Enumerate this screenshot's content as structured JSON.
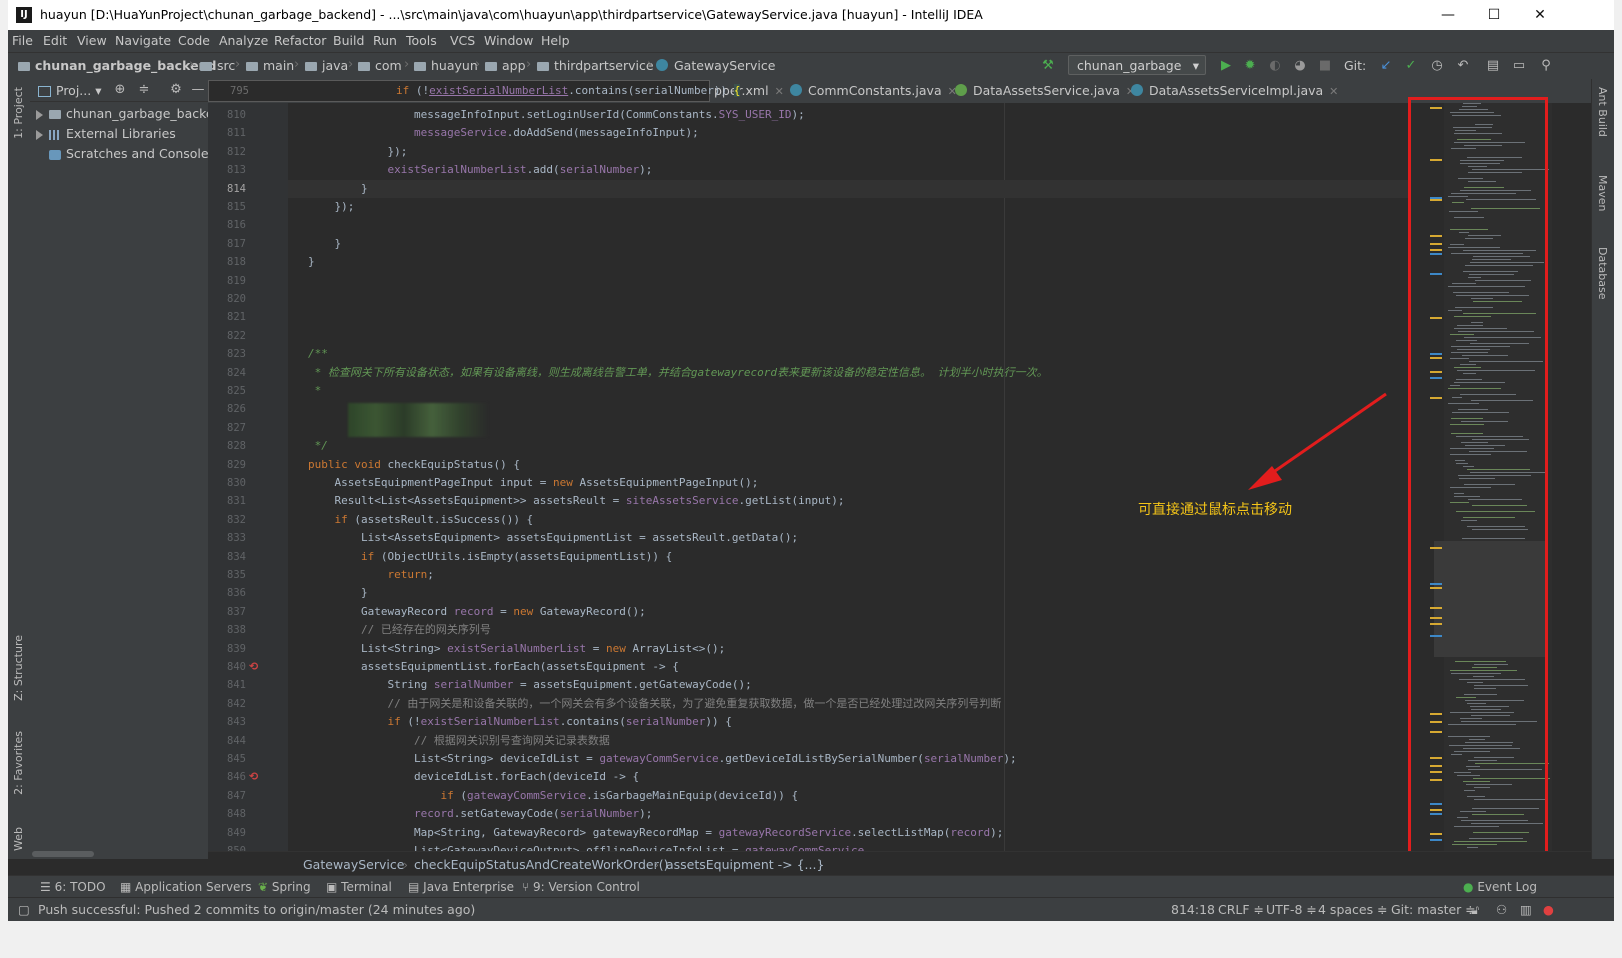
{
  "window": {
    "title": "huayun [D:\\HuaYunProject\\chunan_garbage_backend] - ...\\src\\main\\java\\com\\huayun\\app\\thirdpartservice\\GatewayService.java [huayun] - IntelliJ IDEA",
    "app_icon": "IJ",
    "minimize": "—",
    "maximize": "☐",
    "close": "✕"
  },
  "menu": [
    "File",
    "Edit",
    "View",
    "Navigate",
    "Code",
    "Analyze",
    "Refactor",
    "Build",
    "Run",
    "Tools",
    "VCS",
    "Window",
    "Help"
  ],
  "navbar": {
    "crumbs": [
      "chunan_garbage_backend",
      "src",
      "main",
      "java",
      "com",
      "huayun",
      "app",
      "thirdpartservice",
      "GatewayService"
    ],
    "run_config": "chunan_garbage",
    "git_label": "Git:"
  },
  "left_tools": {
    "project": "1: Project",
    "structure": "Z: Structure",
    "favorites": "2: Favorites",
    "web": "Web"
  },
  "right_tools": {
    "ant": "Ant Build",
    "maven": "Maven",
    "database": "Database"
  },
  "project_panel": {
    "header": "Proj...",
    "items": [
      "chunan_garbage_backend",
      "External Libraries",
      "Scratches and Consoles"
    ]
  },
  "tabs": [
    "pper.xml",
    "CommConstants.java",
    "DataAssetsService.java",
    "DataAssetsServiceImpl.java"
  ],
  "popup_line": {
    "num": "795",
    "code": "if (!existSerialNumberList.contains(serialNumber)) {"
  },
  "code_lines": [
    {
      "n": "810",
      "t": "                messageInfoInput.setLoginUserId(CommConstants.SYS_USER_ID);"
    },
    {
      "n": "811",
      "t": "                messageService.doAddSend(messageInfoInput);"
    },
    {
      "n": "812",
      "t": "            });"
    },
    {
      "n": "813",
      "t": "            existSerialNumberList.add(serialNumber);"
    },
    {
      "n": "814",
      "t": "        }"
    },
    {
      "n": "815",
      "t": "    });"
    },
    {
      "n": "816",
      "t": ""
    },
    {
      "n": "817",
      "t": "    }"
    },
    {
      "n": "818",
      "t": "}"
    },
    {
      "n": "819",
      "t": ""
    },
    {
      "n": "820",
      "t": ""
    },
    {
      "n": "821",
      "t": ""
    },
    {
      "n": "822",
      "t": ""
    },
    {
      "n": "823",
      "t": "/**"
    },
    {
      "n": "824",
      "t": " * 检查网关下所有设备状态，如果有设备离线，则生成离线告警工单，并结合gatewayrecord表来更新该设备的稳定性信息。 计划半小时执行一次。"
    },
    {
      "n": "825",
      "t": " *"
    },
    {
      "n": "826",
      "t": ""
    },
    {
      "n": "827",
      "t": ""
    },
    {
      "n": "828",
      "t": " */"
    },
    {
      "n": "829",
      "t": "public void checkEquipStatus() {"
    },
    {
      "n": "830",
      "t": "    AssetsEquipmentPageInput input = new AssetsEquipmentPageInput();"
    },
    {
      "n": "831",
      "t": "    Result<List<AssetsEquipment>> assetsReult = siteAssetsService.getList(input);"
    },
    {
      "n": "832",
      "t": "    if (assetsReult.isSuccess()) {"
    },
    {
      "n": "833",
      "t": "        List<AssetsEquipment> assetsEquipmentList = assetsReult.getData();"
    },
    {
      "n": "834",
      "t": "        if (ObjectUtils.isEmpty(assetsEquipmentList)) {"
    },
    {
      "n": "835",
      "t": "            return;"
    },
    {
      "n": "836",
      "t": "        }"
    },
    {
      "n": "837",
      "t": "        GatewayRecord record = new GatewayRecord();"
    },
    {
      "n": "838",
      "t": "        // 已经存在的网关序列号"
    },
    {
      "n": "839",
      "t": "        List<String> existSerialNumberList = new ArrayList<>();"
    },
    {
      "n": "840",
      "t": "        assetsEquipmentList.forEach(assetsEquipment -> {"
    },
    {
      "n": "841",
      "t": "            String serialNumber = assetsEquipment.getGatewayCode();"
    },
    {
      "n": "842",
      "t": "            // 由于网关是和设备关联的，一个网关会有多个设备关联，为了避免重复获取数据，做一个是否已经处理过改网关序列号判断"
    },
    {
      "n": "843",
      "t": "            if (!existSerialNumberList.contains(serialNumber)) {"
    },
    {
      "n": "844",
      "t": "                // 根据网关识别号查询网关记录表数据"
    },
    {
      "n": "845",
      "t": "                List<String> deviceIdList = gatewayCommService.getDeviceIdListBySerialNumber(serialNumber);"
    },
    {
      "n": "846",
      "t": "                deviceIdList.forEach(deviceId -> {"
    },
    {
      "n": "847",
      "t": "                    if (gatewayCommService.isGarbageMainEquip(deviceId)) {"
    },
    {
      "n": "848",
      "t": "                record.setGatewayCode(serialNumber);"
    },
    {
      "n": "849",
      "t": "                Map<String, GatewayRecord> gatewayRecordMap = gatewayRecordService.selectListMap(record);"
    },
    {
      "n": "850",
      "t": "                List<GatewayDeviceOutput> offlineDeviceInfoList = gatewayCommService"
    }
  ],
  "annotation": "可直接通过鼠标点击移动",
  "editor_breadcrumbs": [
    "GatewayService",
    "checkEquipStatusAndCreateWorkOrder()",
    "assetsEquipment -> {...}"
  ],
  "bottom_tools": [
    "6: TODO",
    "Application Servers",
    "Spring",
    "Terminal",
    "Java Enterprise",
    "9: Version Control",
    "Event Log"
  ],
  "status": {
    "message": "Push successful: Pushed 2 commits to origin/master (24 minutes ago)",
    "position": "814:18",
    "line_sep": "CRLF ≑",
    "encoding": "UTF-8 ≑",
    "indent": "4 spaces ≑",
    "git": "Git: master ≑"
  },
  "colors": {
    "accent_red": "#e21d1d",
    "annotation": "#f5c518",
    "keyword": "#cc7832",
    "field": "#9876aa",
    "comment": "#629755"
  }
}
